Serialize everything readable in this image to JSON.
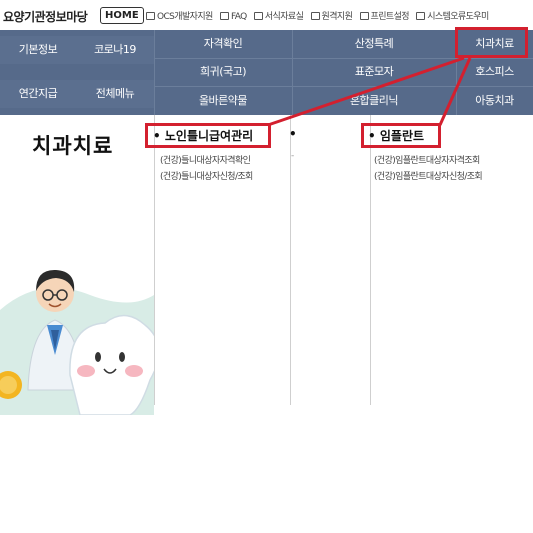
{
  "header": {
    "site_title": "요양기관정보마당",
    "home_label": "HOME",
    "links": [
      "OCS개발자지원",
      "FAQ",
      "서식자료실",
      "원격지원",
      "프린트설정",
      "시스템오류도우미"
    ]
  },
  "nav": {
    "left": [
      "기본정보",
      "코로나19",
      "연간지급",
      "전체메뉴"
    ],
    "row1": [
      "자격확인",
      "산정특례",
      "치과치료"
    ],
    "row2": [
      "희귀(국고)",
      "표준모자",
      "호스피스"
    ],
    "row3": [
      "올바른약물",
      "혼합클리닉",
      "아동치과"
    ]
  },
  "main": {
    "title": "치과치료",
    "col1": {
      "title": "노인틀니급여관리",
      "items": [
        "(건강)틀니대상자자격확인",
        "(건강)틀니대상자신청/조회"
      ]
    },
    "col3": {
      "title": "임플란트",
      "items": [
        "(건강)임플란트대상자자격조회",
        "(건강)임플란트대상자신청/조회"
      ]
    }
  },
  "colors": {
    "nav_bg": "#566a8a",
    "highlight": "#d3202f"
  }
}
